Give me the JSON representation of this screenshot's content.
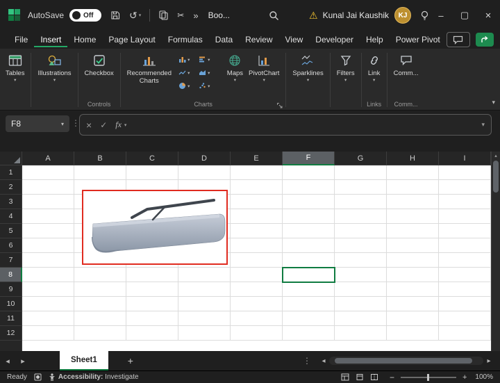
{
  "titlebar": {
    "autosave_label": "AutoSave",
    "autosave_state": "Off",
    "doc_title": "Boo...",
    "user_name": "Kunal Jai Kaushik",
    "user_initials": "KJ"
  },
  "menubar": {
    "tabs": [
      "File",
      "Insert",
      "Home",
      "Page Layout",
      "Formulas",
      "Data",
      "Review",
      "View",
      "Developer",
      "Help",
      "Power Pivot"
    ],
    "active_tab": "Insert"
  },
  "ribbon": {
    "tables_label": "Tables",
    "illustrations_label": "Illustrations",
    "checkbox_label": "Checkbox",
    "controls_group": "Controls",
    "recommended_charts_label": "Recommended Charts",
    "maps_label": "Maps",
    "pivotchart_label": "PivotChart",
    "charts_group": "Charts",
    "sparklines_label": "Sparklines",
    "filters_label": "Filters",
    "link_label": "Link",
    "links_group": "Links",
    "comments_label": "Comm...",
    "comments_group": "Comm..."
  },
  "formula_bar": {
    "name_box": "F8",
    "fx_label": "fx",
    "formula_value": ""
  },
  "grid": {
    "columns": [
      "A",
      "B",
      "C",
      "D",
      "E",
      "F",
      "G",
      "H",
      "I"
    ],
    "rows": [
      "1",
      "2",
      "3",
      "4",
      "5",
      "6",
      "7",
      "8",
      "9",
      "10",
      "11",
      "12"
    ],
    "selected_column": "F",
    "selected_row": "8",
    "active_cell": "F8"
  },
  "sheet_bar": {
    "tabs": [
      "Sheet1"
    ],
    "active_tab": "Sheet1"
  },
  "status_bar": {
    "ready_label": "Ready",
    "accessibility_prefix": "Accessibility:",
    "accessibility_label": " Investigate",
    "zoom_level": "100%"
  },
  "icons": {
    "chevron": "▾",
    "undo": "↺",
    "scissors": "✂",
    "more": "»",
    "warning": "⚠",
    "minimize": "–",
    "maximize": "▢",
    "close": "×",
    "cancel": "×",
    "enter": "✓",
    "dots": "⋮",
    "left": "◂",
    "right": "▸",
    "up": "▴",
    "plus": "+",
    "minus": "−"
  },
  "colors": {
    "accent_green": "#107C41",
    "titlebar_bg": "#1f1f1f",
    "ribbon_bg": "#2a2a2a",
    "image_border_red": "#e02b20"
  }
}
